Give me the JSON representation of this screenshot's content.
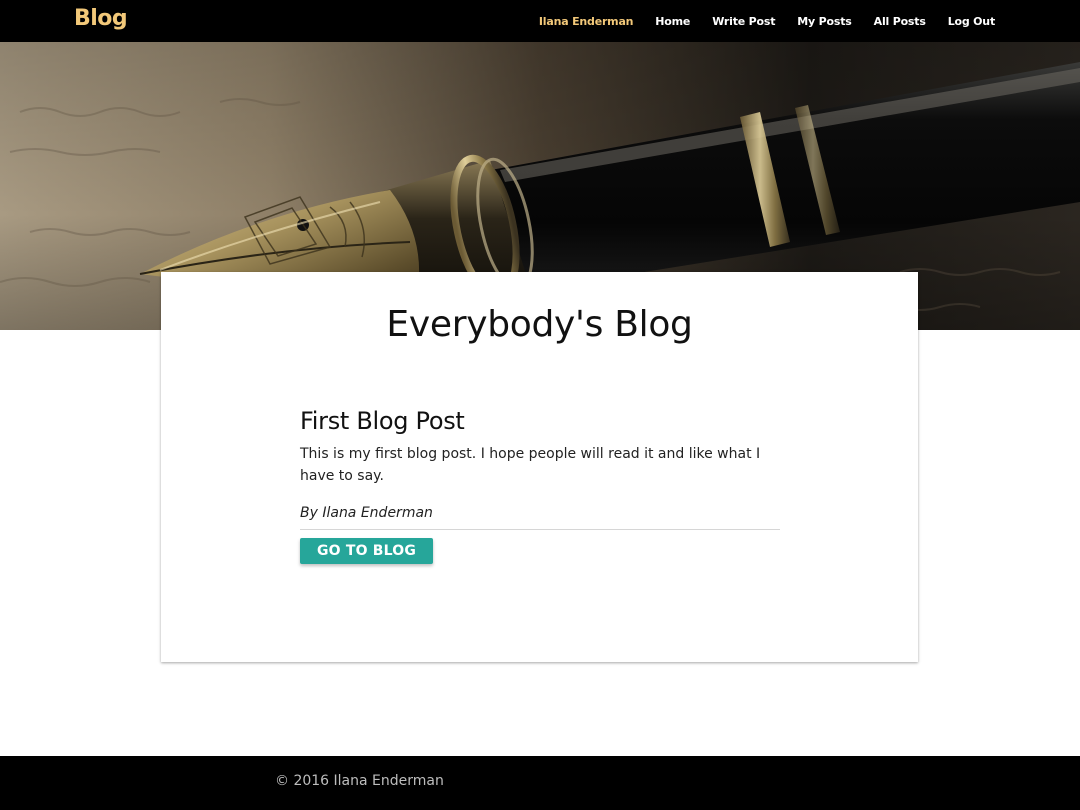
{
  "navbar": {
    "brand": "Blog",
    "user_name": "Ilana Enderman",
    "links": [
      "Home",
      "Write Post",
      "My Posts",
      "All Posts",
      "Log Out"
    ]
  },
  "hero": {
    "image": "fountain-pen-photo"
  },
  "main": {
    "title": "Everybody's Blog",
    "post": {
      "title": "First Blog Post",
      "body": "This is my first blog post. I hope people will read it and like what I have to say.",
      "author": "By Ilana Enderman",
      "button_label": "Go to blog"
    }
  },
  "footer": {
    "copyright": "© 2016 Ilana Enderman"
  },
  "colors": {
    "nav_background": "#000000",
    "brand": "#f2c879",
    "accent_button": "#26a69a",
    "footer_background": "#000000"
  }
}
